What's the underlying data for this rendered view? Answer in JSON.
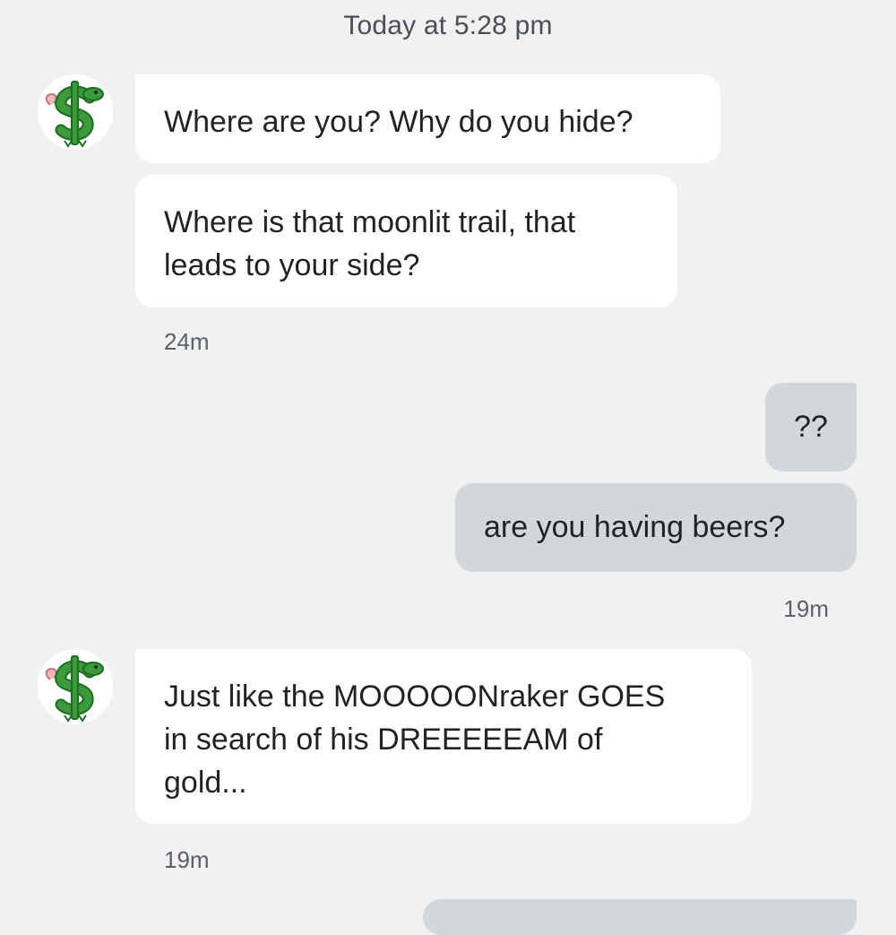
{
  "day_header": "Today at 5:28 pm",
  "contact": {
    "avatar_icon": "green-dollar-dragon-icon",
    "avatar_colors": {
      "body": "#3c9a3c",
      "outline": "#1e6b22",
      "accent": "#f2b6b6"
    }
  },
  "messages": [
    {
      "direction": "incoming",
      "text": "Where are you? Why do you hide?"
    },
    {
      "direction": "incoming",
      "text": "Where is that moonlit trail, that\nleads to your side?"
    },
    {
      "direction": "incoming",
      "text": "Just like the MOOOOONraker GOES\nin search of his DREEEEEAM of\ngold..."
    },
    {
      "direction": "outgoing",
      "text": "??"
    },
    {
      "direction": "outgoing",
      "text": "are you having beers?"
    }
  ],
  "timestamps": [
    "24m",
    "19m",
    "19m"
  ],
  "colors": {
    "background": "#f1f1f2",
    "incoming_bubble": "#ffffff",
    "outgoing_bubble": "#d2d7db"
  }
}
